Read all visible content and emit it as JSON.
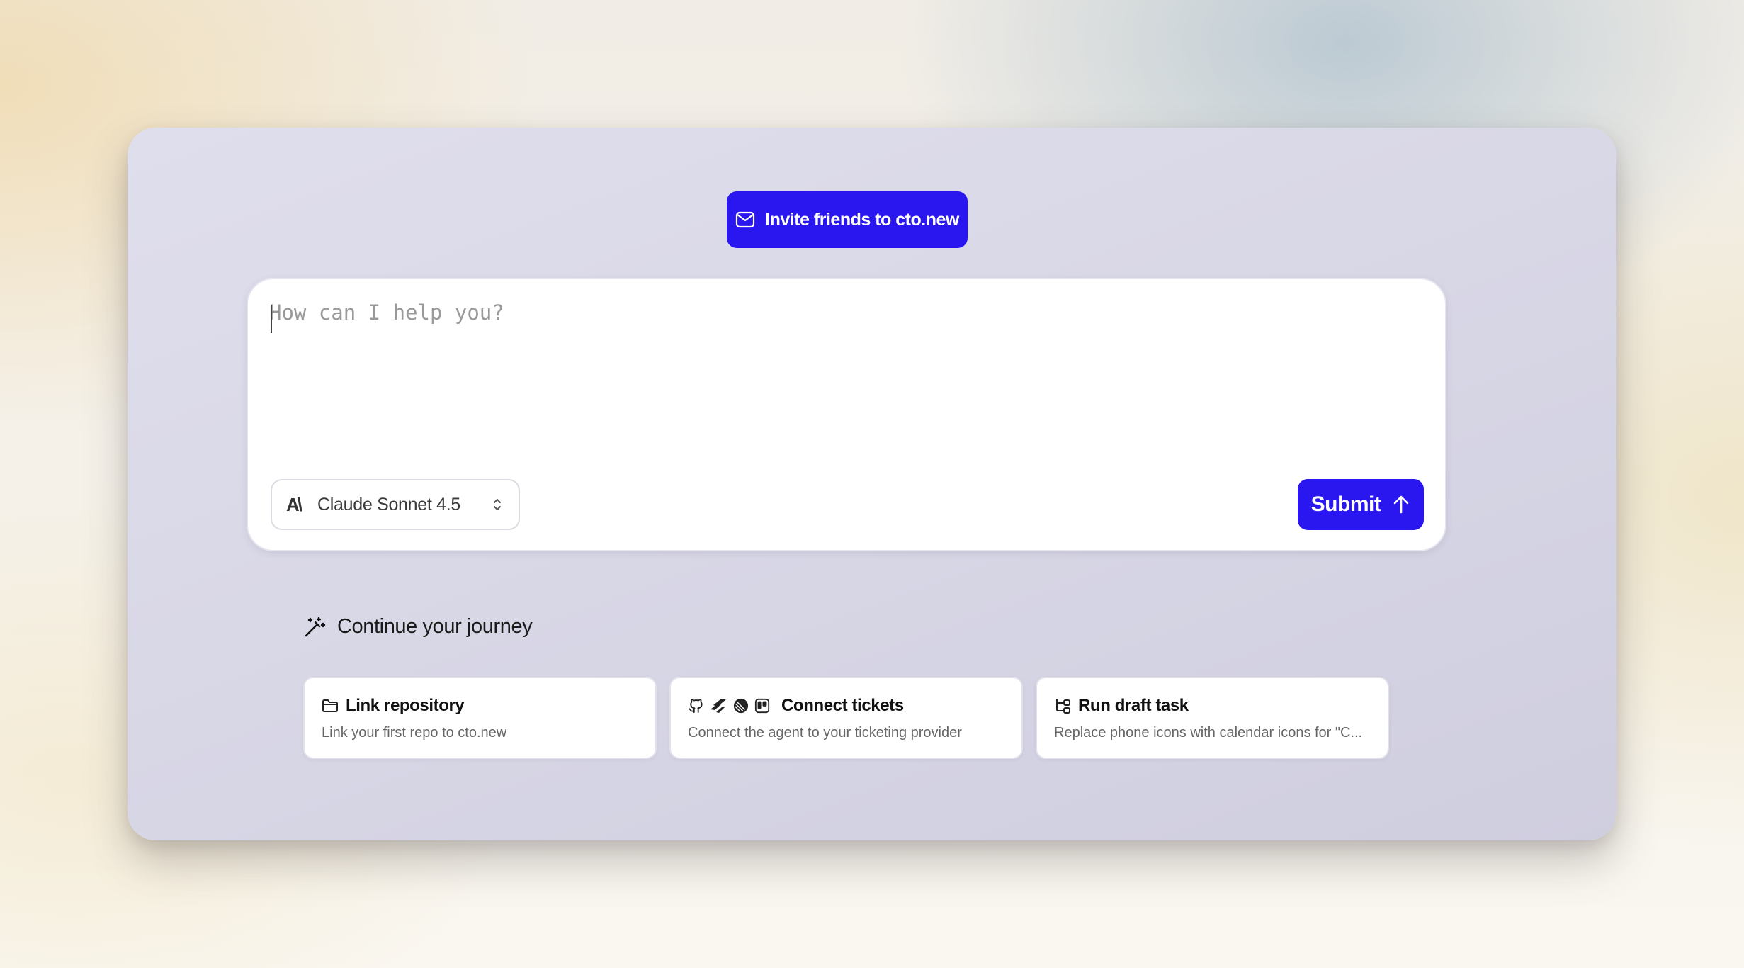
{
  "invite": {
    "label": "Invite friends to cto.new",
    "icon": "mail-icon"
  },
  "prompt": {
    "placeholder": "How can I help you?",
    "value": ""
  },
  "model_select": {
    "logo": "A\\",
    "selected": "Claude Sonnet 4.5",
    "icon": "chevron-up-down-icon"
  },
  "submit": {
    "label": "Submit",
    "icon": "arrow-up-icon"
  },
  "journey": {
    "title": "Continue your journey",
    "icon": "magic-wand-icon",
    "cards": [
      {
        "title": "Link repository",
        "description": "Link your first repo to cto.new",
        "icons": [
          "folder-icon"
        ]
      },
      {
        "title": "Connect tickets",
        "description": "Connect the agent to your ticketing provider",
        "icons": [
          "github-icon",
          "jira-icon",
          "linear-icon",
          "trello-icon"
        ]
      },
      {
        "title": "Run draft task",
        "description": "Replace phone icons with calendar icons for \"C...",
        "icons": [
          "workflow-icon"
        ]
      }
    ]
  },
  "colors": {
    "accent": "#2a17f0",
    "card_bg": "#ffffff",
    "frame_bg": "#dcdbe9"
  }
}
